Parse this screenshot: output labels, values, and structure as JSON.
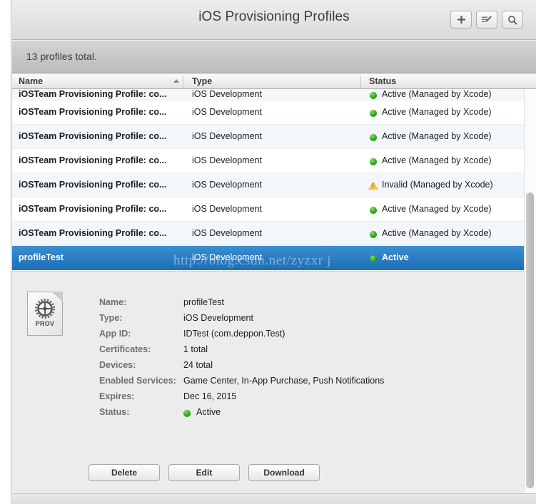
{
  "window": {
    "title": "iOS Provisioning Profiles"
  },
  "toolbar": {
    "add_label": "+",
    "add_name": "plus-icon",
    "edit_name": "edit-pencil-icon",
    "search_name": "search-icon"
  },
  "summary": {
    "text": "13 profiles total."
  },
  "columns": [
    {
      "key": "name",
      "label": "Name"
    },
    {
      "key": "type",
      "label": "Type"
    },
    {
      "key": "status",
      "label": "Status"
    }
  ],
  "sort": {
    "column": "Name",
    "direction": "ascending"
  },
  "rows": [
    {
      "name": "iOSTeam Provisioning Profile: co...",
      "type": "iOS Development",
      "status": "Active (Managed by Xcode)",
      "status_kind": "active",
      "selected": false
    },
    {
      "name": "iOSTeam Provisioning Profile: co...",
      "type": "iOS Development",
      "status": "Active (Managed by Xcode)",
      "status_kind": "active",
      "selected": false
    },
    {
      "name": "iOSTeam Provisioning Profile: co...",
      "type": "iOS Development",
      "status": "Active (Managed by Xcode)",
      "status_kind": "active",
      "selected": false
    },
    {
      "name": "iOSTeam Provisioning Profile: co...",
      "type": "iOS Development",
      "status": "Active (Managed by Xcode)",
      "status_kind": "active",
      "selected": false
    },
    {
      "name": "iOSTeam Provisioning Profile: co...",
      "type": "iOS Development",
      "status": "Invalid (Managed by Xcode)",
      "status_kind": "invalid",
      "selected": false
    },
    {
      "name": "iOSTeam Provisioning Profile: co...",
      "type": "iOS Development",
      "status": "Active (Managed by Xcode)",
      "status_kind": "active",
      "selected": false
    },
    {
      "name": "iOSTeam Provisioning Profile: co...",
      "type": "iOS Development",
      "status": "Active (Managed by Xcode)",
      "status_kind": "active",
      "selected": false
    },
    {
      "name": "profileTest",
      "type": "iOS Development",
      "status": "Active",
      "status_kind": "active",
      "selected": true
    }
  ],
  "watermark": {
    "text": "http://blog.csdn.net/zyzxr j"
  },
  "detail": {
    "icon_label": "PROV",
    "icon_name": "provisioning-profile-document-icon",
    "fields": [
      {
        "label": "Name:",
        "value": "profileTest"
      },
      {
        "label": "Type:",
        "value": "iOS Development"
      },
      {
        "label": "App ID:",
        "value": "IDTest (com.deppon.Test)"
      },
      {
        "label": "Certificates:",
        "value": "1 total"
      },
      {
        "label": "Devices:",
        "value": "24 total"
      },
      {
        "label": "Enabled Services:",
        "value": "Game Center, In-App Purchase, Push Notifications"
      },
      {
        "label": "Expires:",
        "value": "Dec 16, 2015"
      }
    ],
    "status_field": {
      "label": "Status:",
      "value": "Active"
    }
  },
  "actions": [
    {
      "label": "Delete"
    },
    {
      "label": "Edit"
    },
    {
      "label": "Download"
    }
  ],
  "colors": {
    "selection_blue": "#2b7ec4",
    "status_active_green": "#35b522",
    "status_invalid_amber": "#f5c441",
    "alt_row": "#f3f6fa",
    "detail_bg": "#ececec"
  }
}
